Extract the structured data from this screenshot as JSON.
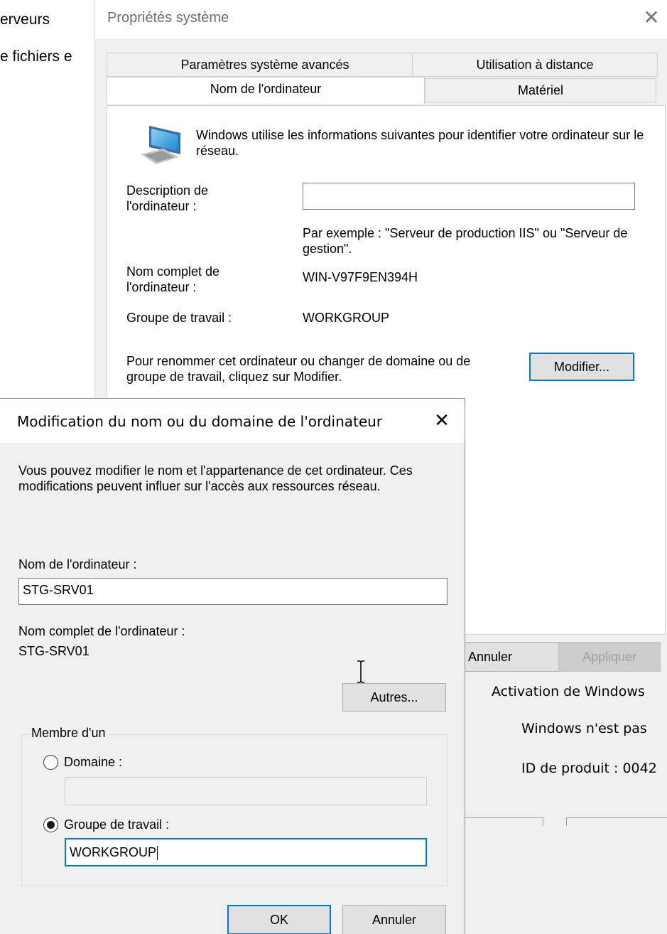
{
  "background": {
    "items": [
      "erveurs",
      "e fichiers e"
    ]
  },
  "sysprops": {
    "title": "Propriétés système",
    "tabs": {
      "row1": [
        "Paramètres système avancés",
        "Utilisation à distance"
      ],
      "row2": [
        "Nom de l'ordinateur",
        "Matériel"
      ]
    },
    "info_text": "Windows utilise les informations suivantes pour identifier votre ordinateur sur le réseau.",
    "description_label": "Description de l'ordinateur :",
    "description_value": "",
    "example_text": "Par exemple : \"Serveur de production IIS\" ou \"Serveur de gestion\".",
    "fullname_label": "Nom complet de l'ordinateur :",
    "fullname_value": "WIN-V97F9EN394H",
    "workgroup_label": "Groupe de travail :",
    "workgroup_value": "WORKGROUP",
    "rename_text": "Pour renommer cet ordinateur ou changer de domaine ou de groupe de travail, cliquez sur Modifier.",
    "modify_button": "Modifier...",
    "cancel_button": "Annuler",
    "apply_button": "Appliquer"
  },
  "activation": {
    "heading": "Activation de Windows",
    "status": "Windows n'est pas",
    "product_id": "ID de produit : 0042"
  },
  "modal": {
    "title": "Modification du nom ou du domaine de l'ordinateur",
    "intro": "Vous pouvez modifier le nom et l'appartenance de cet ordinateur. Ces modifications peuvent influer sur l'accès aux ressources réseau.",
    "name_label": "Nom de l'ordinateur :",
    "name_value": "STG-SRV01",
    "fullname_label": "Nom complet de l'ordinateur :",
    "fullname_value": "STG-SRV01",
    "others_button": "Autres...",
    "member_of": "Membre d'un",
    "domain_label": "Domaine :",
    "domain_value": "",
    "workgroup_label": "Groupe de travail :",
    "workgroup_value": "WORKGROUP",
    "ok_button": "OK",
    "cancel_button": "Annuler",
    "selected_membership": "workgroup"
  },
  "colors": {
    "accent": "#0078d7",
    "window_bg": "#f0f0f0"
  },
  "icons": [
    "computer-icon",
    "close-icon",
    "text-cursor-icon"
  ]
}
